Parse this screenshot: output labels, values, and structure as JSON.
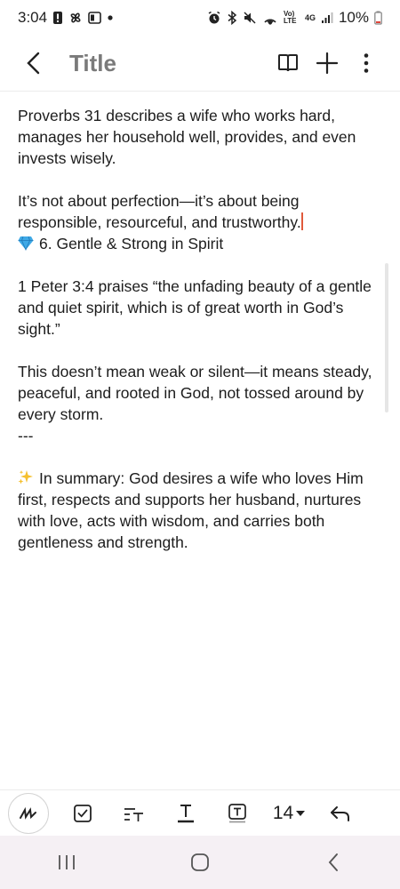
{
  "status_bar": {
    "time": "3:04",
    "network_label": "Vo) LTE",
    "network_type": "4G",
    "battery": "10%",
    "left_icons": [
      "alert-icon",
      "pinwheel-icon",
      "screen-icon",
      "dot-icon"
    ],
    "right_icons": [
      "alarm-icon",
      "bluetooth-icon",
      "mute-icon",
      "hotspot-icon",
      "signal-icon",
      "battery-icon"
    ]
  },
  "app_bar": {
    "title": "Title"
  },
  "note": {
    "para1": "Proverbs 31 describes a wife who works hard, manages her household well, provides, and even invests wisely.",
    "para2_line1": "It’s not about perfection—it’s about being responsible, resourceful, and trustworthy.",
    "para2_line2": "6. Gentle & Strong in Spirit",
    "para3": "1 Peter 3:4 praises “the unfading beauty of a gentle and quiet spirit, which is of great worth in God’s sight.”",
    "para4": "This doesn’t mean weak or silent—it means steady, peaceful, and rooted in God, not tossed around by every storm.",
    "separator": "---",
    "para5": "In summary: God desires a wife who loves Him first, respects and supports her husband, nurtures with love, acts with wisdom, and carries both gentleness and strength."
  },
  "toolbar": {
    "font_size": "14"
  },
  "colors": {
    "caret": "#e05a3c",
    "gem": "#3fa9e6",
    "sparkle": "#f5c02e",
    "nav_bg": "#f5f0f4"
  }
}
